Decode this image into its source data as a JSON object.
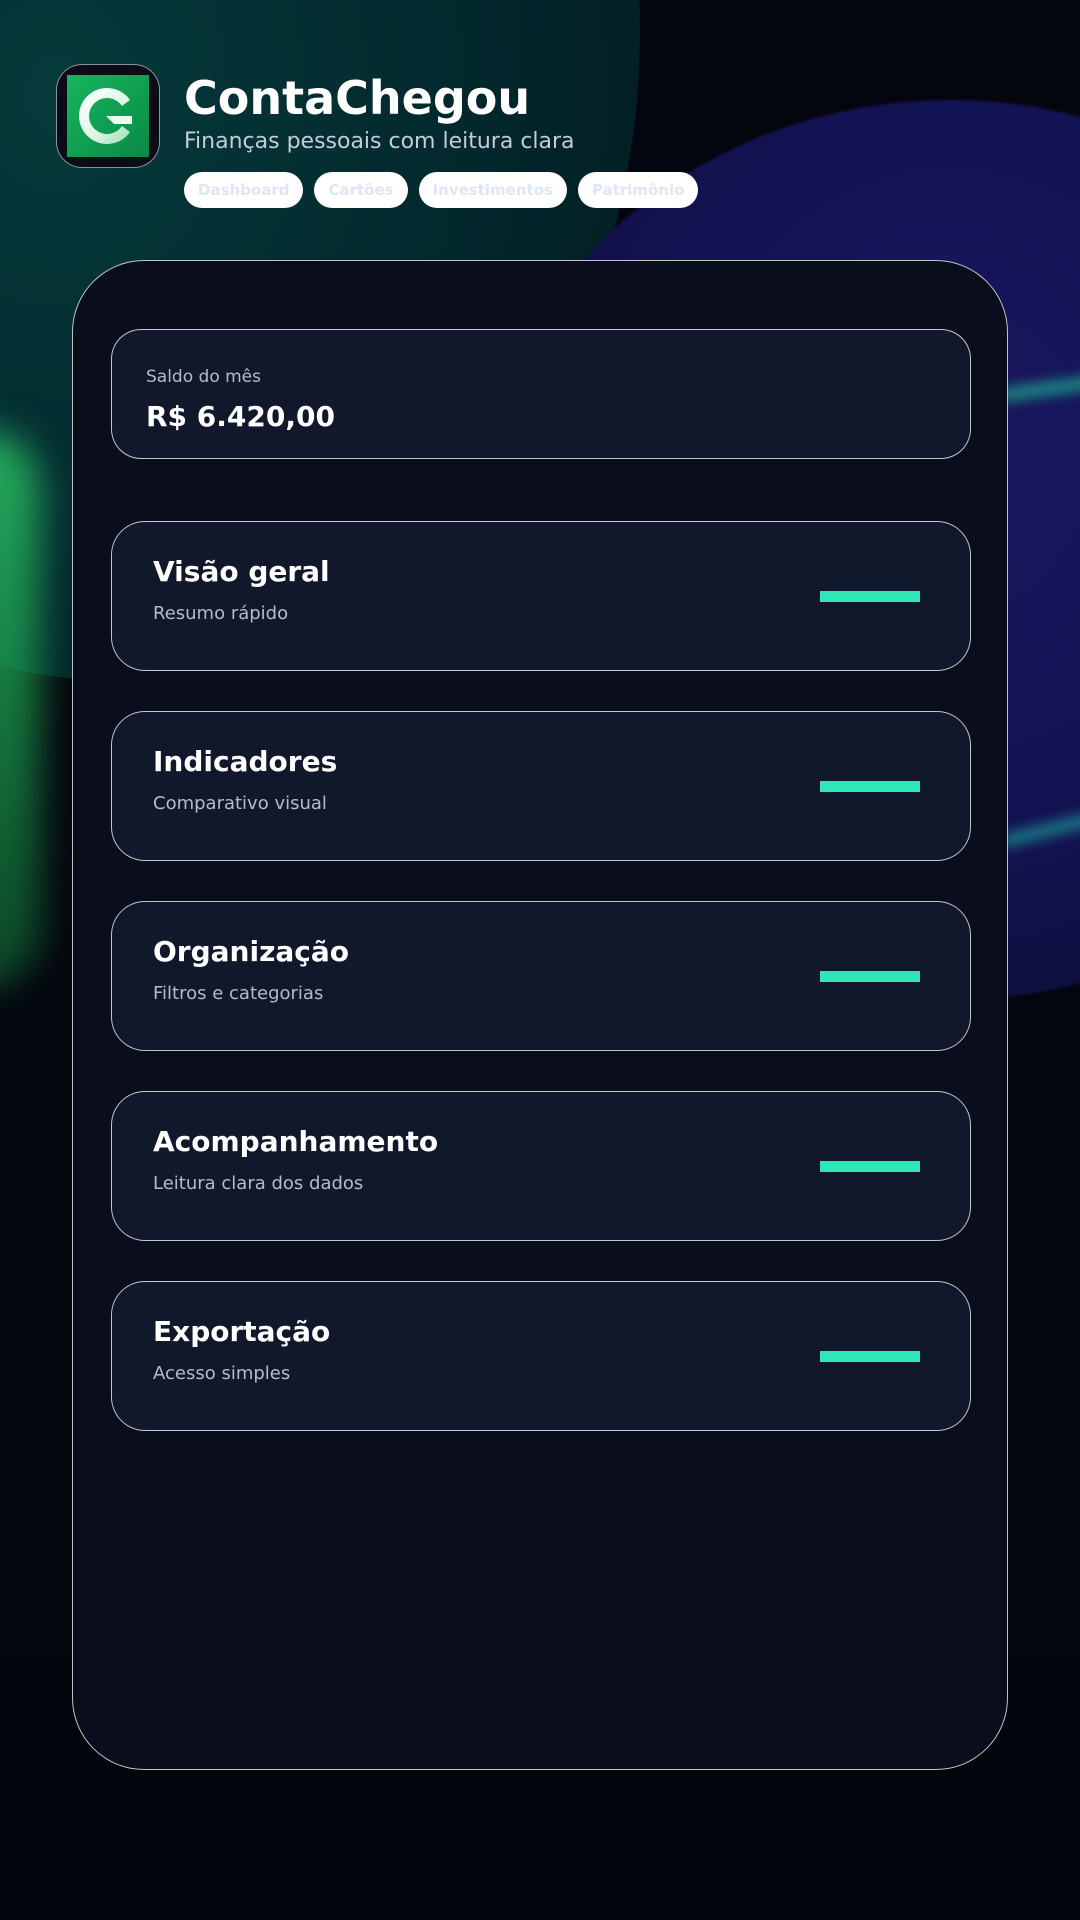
{
  "app": {
    "title": "ContaChegou",
    "subtitle": "Finanças pessoais com leitura clara",
    "logo_icon": "contachegou-logo-icon"
  },
  "tabs": [
    {
      "label": "Dashboard"
    },
    {
      "label": "Cartões"
    },
    {
      "label": "Investimentos"
    },
    {
      "label": "Patrimônio"
    }
  ],
  "balance": {
    "label": "Saldo do mês",
    "value": "R$ 6.420,00"
  },
  "features": [
    {
      "title": "Visão geral",
      "subtitle": "Resumo rápido"
    },
    {
      "title": "Indicadores",
      "subtitle": "Comparativo visual"
    },
    {
      "title": "Organização",
      "subtitle": "Filtros e categorias"
    },
    {
      "title": "Acompanhamento",
      "subtitle": "Leitura clara dos dados"
    },
    {
      "title": "Exportação",
      "subtitle": "Acesso simples"
    }
  ],
  "colors": {
    "accent": "#2ee6b6",
    "background": "#04060f",
    "card": "#11182c",
    "panel": "#0a0d1c",
    "logo_green": "#18b45f"
  }
}
